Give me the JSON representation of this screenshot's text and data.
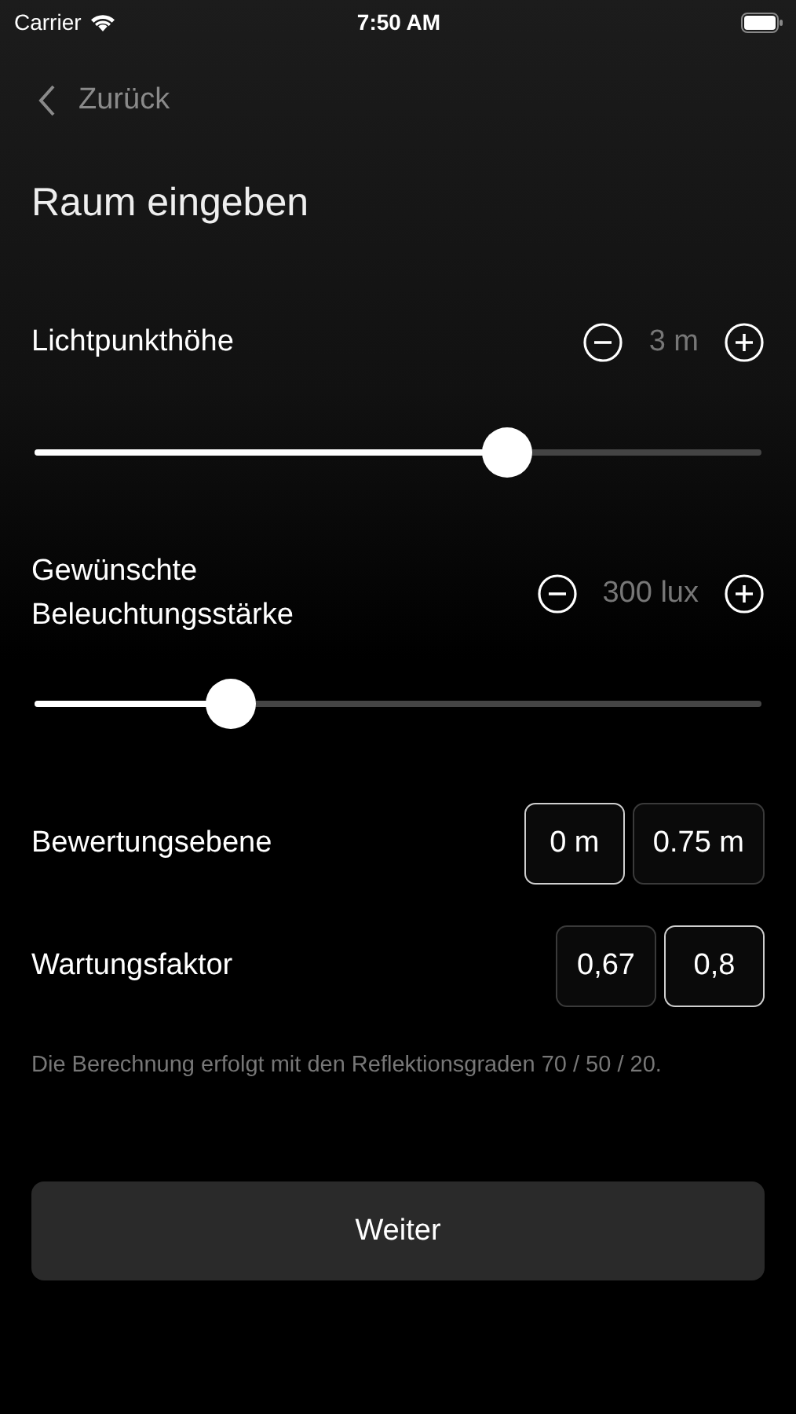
{
  "status_bar": {
    "carrier": "Carrier",
    "time": "7:50 AM"
  },
  "nav": {
    "back_label": "Zurück"
  },
  "title": "Raum eingeben",
  "steppers": [
    {
      "label": "Lichtpunkthöhe",
      "value": "3 m",
      "level": 0.65
    },
    {
      "label": "Gewünschte Beleuchtungsstärke",
      "value": "300 lux",
      "level": 0.27
    }
  ],
  "option_groups": [
    {
      "label": "Bewertungsebene",
      "options": [
        {
          "label": "0 m",
          "selected": true
        },
        {
          "label": "0.75 m",
          "selected": false
        }
      ]
    },
    {
      "label": "Wartungsfaktor",
      "options": [
        {
          "label": "0,67",
          "selected": false
        },
        {
          "label": "0,8",
          "selected": true
        }
      ]
    }
  ],
  "note": "Die Berechnung erfolgt mit den Reflektionsgraden 70 / 50 / 20.",
  "primary_button": "Weiter"
}
